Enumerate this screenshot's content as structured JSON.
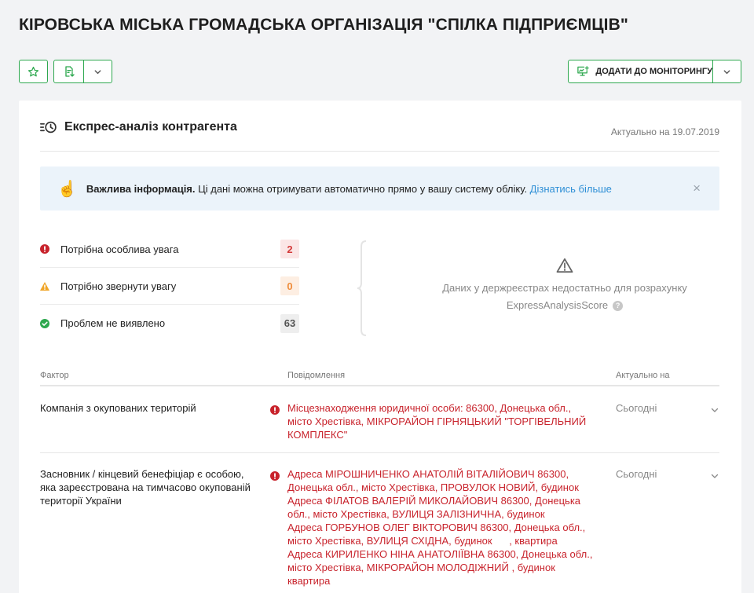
{
  "page": {
    "title": "КІРОВСЬКА МІСЬКА ГРОМАДСЬКА ОРГАНІЗАЦІЯ \"СПІЛКА ПІДПРИЄМЦІВ\""
  },
  "toolbar": {
    "favorite_icon": "star-icon",
    "export_icon": "document-download-icon",
    "dropdown_icon": "chevron-down-icon",
    "monitor_label": "ДОДАТИ ДО МОНІТОРИНГУ",
    "monitor_icon": "monitor-add-icon"
  },
  "section": {
    "title": "Експрес-аналіз контрагента",
    "actual_date": "Актуально на 19.07.2019"
  },
  "banner": {
    "bold": "Важлива інформація.",
    "text": " Ці дані можна отримувати автоматично прямо у вашу систему обліку. ",
    "link": "Дізнатись більше",
    "close": "×"
  },
  "stats": [
    {
      "label": "Потрібна особлива увага",
      "count": "2",
      "status": "critical",
      "color": "#d33a3a"
    },
    {
      "label": "Потрібно звернути увагу",
      "count": "0",
      "status": "warning",
      "color": "#ef8c3a"
    },
    {
      "label": "Проблем не виявлено",
      "count": "63",
      "status": "ok",
      "color": "#2ea84f"
    }
  ],
  "score": {
    "message_line1": "Даних у держреєстрах недостатньо для розрахунку",
    "message_line2": "ExpressAnalysisScore",
    "help": "?"
  },
  "table": {
    "headers": [
      "Фактор",
      "Повідомлення",
      "Актуально на"
    ],
    "rows": [
      {
        "factor": "Компанія з окупованих територій",
        "message": "Місцезнаходження юридичної особи: 86300, Донецька обл., місто Хрестівка, МІКРОРАЙОН ГІРНЯЦЬКИЙ \"ТОРГІВЕЛЬНИЙ КОМПЛЕКС\"",
        "date": "Сьогодні"
      },
      {
        "factor": "Засновник / кінцевий бенефіціар є особою, яка зареєстрована на тимчасово окупованій території України",
        "message_lines": [
          "Адреса МІРОШНИЧЕНКО АНАТОЛІЙ ВІТАЛІЙОВИЧ 86300,",
          "Донецька обл., місто Хрестівка, ПРОВУЛОК НОВИЙ, будинок",
          "Адреса ФІЛАТОВ ВАЛЕРІЙ МИКОЛАЙОВИЧ 86300, Донецька",
          "обл., місто Хрестівка, ВУЛИЦЯ ЗАЛІЗНИЧНА, будинок",
          "Адреса ГОРБУНОВ ОЛЕГ ВІКТОРОВИЧ 86300, Донецька обл.,",
          "місто Хрестівка, ВУЛИЦЯ СХІДНА, будинок      , квартира",
          "Адреса КИРИЛЕНКО НІНА АНАТОЛІЇВНА 86300, Донецька обл.,",
          "місто Хрестівка, МІКРОРАЙОН МОЛОДІЖНИЙ , будинок",
          "квартира"
        ],
        "date": "Сьогодні"
      }
    ]
  }
}
